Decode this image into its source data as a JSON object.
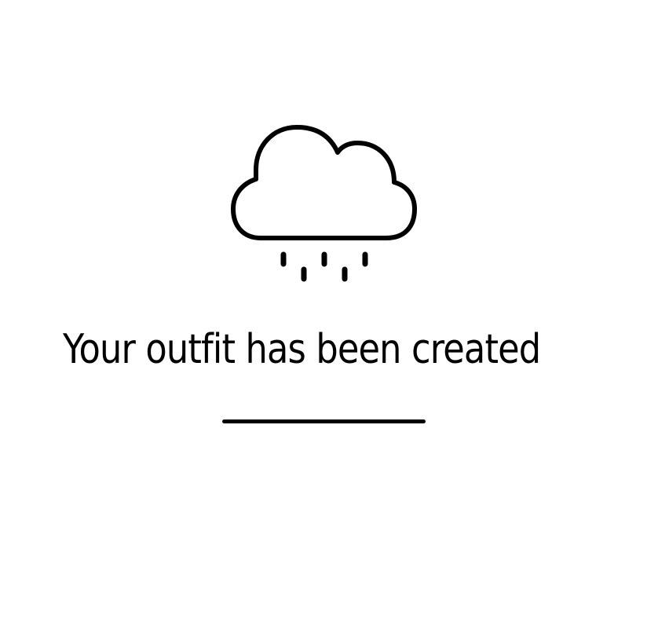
{
  "screen": {
    "icon": "cloud-rain-icon",
    "message": "Your outfit has been created"
  },
  "colors": {
    "background": "#ffffff",
    "foreground": "#000000"
  }
}
